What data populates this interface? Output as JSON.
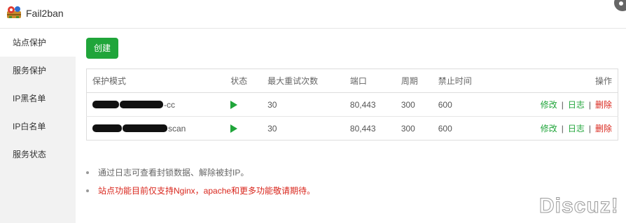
{
  "app": {
    "title": "Fail2ban",
    "icon": "fail2ban-logo-icon"
  },
  "sidebar": {
    "items": [
      {
        "label": "站点保护",
        "active": true
      },
      {
        "label": "服务保护",
        "active": false
      },
      {
        "label": "IP黑名单",
        "active": false
      },
      {
        "label": "IP白名单",
        "active": false
      },
      {
        "label": "服务状态",
        "active": false
      }
    ]
  },
  "toolbar": {
    "create_label": "创建"
  },
  "table": {
    "headers": [
      "保护模式",
      "状态",
      "最大重试次数",
      "端口",
      "周期",
      "禁止时间",
      "操作"
    ],
    "rows": [
      {
        "name_suffix": "-cc",
        "status_icon": "play-icon",
        "max_retry": "30",
        "port": "80,443",
        "period": "300",
        "ban_time": "600"
      },
      {
        "name_suffix": "scan",
        "status_icon": "play-icon",
        "max_retry": "30",
        "port": "80,443",
        "period": "300",
        "ban_time": "600"
      }
    ],
    "actions": {
      "edit": "修改",
      "log": "日志",
      "delete": "删除",
      "separator": "|"
    }
  },
  "notes": [
    "通过日志可查看封锁数据、解除被封IP。",
    "站点功能目前仅支持Nginx，apache和更多功能敬请期待。"
  ],
  "watermark": "Discuz!",
  "colors": {
    "accent": "#20a53a",
    "danger": "#d9261c",
    "sidebar_bg": "#f2f2f2"
  }
}
